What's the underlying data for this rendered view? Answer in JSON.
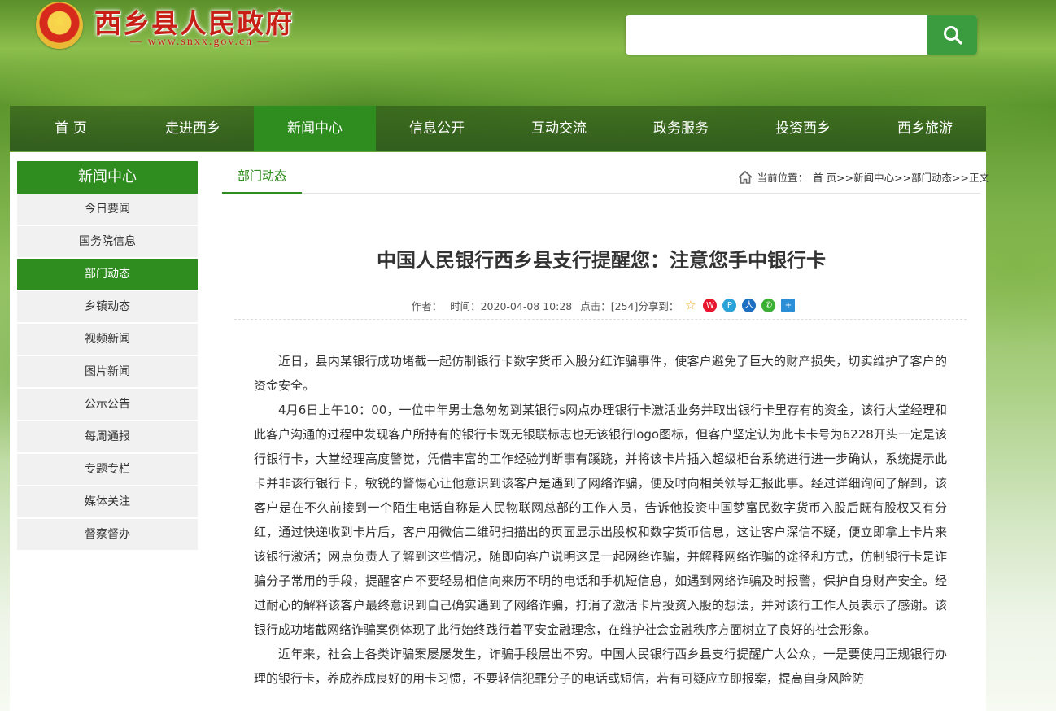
{
  "header": {
    "site_title": "西乡县人民政府",
    "site_url": "— www.snxx.gov.cn —",
    "search_placeholder": ""
  },
  "nav": {
    "items": [
      "首 页",
      "走进西乡",
      "新闻中心",
      "信息公开",
      "互动交流",
      "政务服务",
      "投资西乡",
      "西乡旅游"
    ],
    "active": "新闻中心"
  },
  "sidebar": {
    "title": "新闻中心",
    "items": [
      "今日要闻",
      "国务院信息",
      "部门动态",
      "乡镇动态",
      "视频新闻",
      "图片新闻",
      "公示公告",
      "每周通报",
      "专题专栏",
      "媒体关注",
      "督察督办"
    ],
    "active": "部门动态"
  },
  "main": {
    "tab": "部门动态",
    "breadcrumb": {
      "prefix": "当前位置：",
      "items": [
        "首 页",
        ">>新闻中心",
        ">>部门动态",
        ">>正文"
      ]
    }
  },
  "article": {
    "title": "中国人民银行西乡县支行提醒您：注意您手中银行卡",
    "meta": {
      "author_label": "作者：",
      "time": "时间：2020-04-08 10:28",
      "clicks": "点击：[254]",
      "share_label": "分享到："
    },
    "share_icons": [
      "qzone-icon",
      "weibo-icon",
      "pengyou-icon",
      "renren-icon",
      "wechat-icon",
      "more-share-icon"
    ],
    "paragraphs": [
      "近日，县内某银行成功堵截一起仿制银行卡数字货币入股分红诈骗事件，使客户避免了巨大的财产损失，切实维护了客户的资金安全。",
      "4月6日上午10：00，一位中年男士急匆匆到某银行s网点办理银行卡激活业务并取出银行卡里存有的资金，该行大堂经理和此客户沟通的过程中发现客户所持有的银行卡既无银联标志也无该银行logo图标，但客户坚定认为此卡卡号为6228开头一定是该行银行卡，大堂经理高度警觉，凭借丰富的工作经验判断事有蹊跷，并将该卡片插入超级柜台系统进行进一步确认，系统提示此卡并非该行银行卡，敏锐的警惕心让他意识到该客户是遇到了网络诈骗，便及时向相关领导汇报此事。经过详细询问了解到，该客户是在不久前接到一个陌生电话自称是人民物联网总部的工作人员，告诉他投资中国梦富民数字货币入股后既有股权又有分红，通过快递收到卡片后，客户用微信二维码扫描出的页面显示出股权和数字货币信息，这让客户深信不疑，便立即拿上卡片来该银行激活；网点负责人了解到这些情况，随即向客户说明这是一起网络诈骗，并解释网络诈骗的途径和方式，仿制银行卡是诈骗分子常用的手段，提醒客户不要轻易相信向来历不明的电话和手机短信息，如遇到网络诈骗及时报警，保护自身财产安全。经过耐心的解释该客户最终意识到自己确实遇到了网络诈骗，打消了激活卡片投资入股的想法，并对该行工作人员表示了感谢。该银行成功堵截网络诈骗案例体现了此行始终践行着平安金融理念，在维护社会金融秩序方面树立了良好的社会形象。",
      "近年来，社会上各类诈骗案屡屡发生，诈骗手段层出不穷。中国人民银行西乡县支行提醒广大公众，一是要使用正规银行办理的银行卡，养成养成良好的用卡习惯，不要轻信犯罪分子的电话或短信，若有可疑应立即报案，提高自身风险防"
    ]
  },
  "colors": {
    "brand_red": "#c71f16",
    "accent_green": "#2f8c1f",
    "search_button": "#3a9b3f"
  }
}
